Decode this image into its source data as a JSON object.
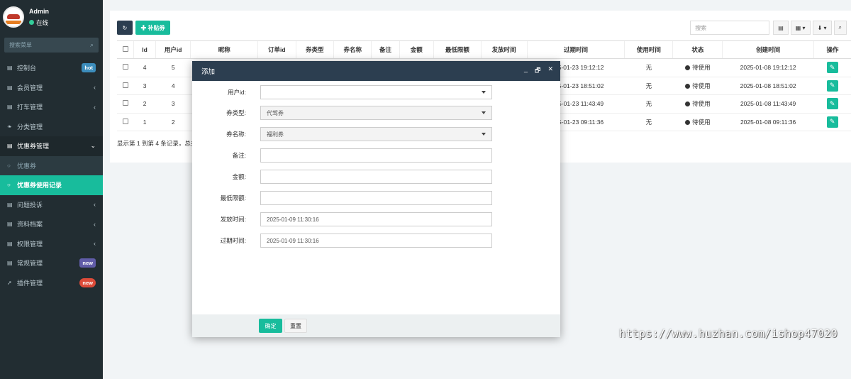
{
  "sidebar": {
    "user_name": "Admin",
    "user_status": "在线",
    "search_placeholder": "搜索菜单",
    "items": [
      {
        "label": "控制台",
        "badge": "hot",
        "badge_color": "#3c8dbc",
        "icon": "dashboard-icon"
      },
      {
        "label": "会员管理",
        "chevron": "‹",
        "icon": "list-icon"
      },
      {
        "label": "打车管理",
        "chevron": "‹",
        "icon": "list-icon"
      },
      {
        "label": "分类管理",
        "icon": "leaf-icon"
      },
      {
        "label": "优惠券管理",
        "chevron": "⌄",
        "icon": "list-icon"
      },
      {
        "label": "优惠券",
        "icon": "circle-icon"
      },
      {
        "label": "优惠券使用记录",
        "icon": "circle-icon"
      },
      {
        "label": "问题投诉",
        "chevron": "‹",
        "icon": "list-icon"
      },
      {
        "label": "资料档案",
        "chevron": "‹",
        "icon": "list-icon"
      },
      {
        "label": "权限管理",
        "chevron": "‹",
        "icon": "list-icon"
      },
      {
        "label": "常规管理",
        "badge": "new",
        "badge_color": "#605ca8",
        "icon": "list-icon"
      },
      {
        "label": "插件管理",
        "badge": "new",
        "badge_color": "#dd4b39",
        "icon": "rocket-icon"
      }
    ]
  },
  "toolbar": {
    "refresh_icon": "↻",
    "add_label": "✚ 补贴券",
    "search_placeholder": "搜索",
    "tool_view": "▤",
    "tool_columns": "▦ ▾",
    "tool_export": "⬇ ▾",
    "tool_search": "⌕"
  },
  "table": {
    "headers": [
      "",
      "Id",
      "用户id",
      "昵称",
      "订单id",
      "券类型",
      "券名称",
      "备注",
      "金额",
      "最低限额",
      "发放时间",
      "过期时间",
      "使用时间",
      "状态",
      "创建时间",
      "操作"
    ],
    "rows": [
      {
        "id": "4",
        "user_id": "5",
        "expire": "2025-01-23 19:12:12",
        "used": "无",
        "status": "待使用",
        "created": "2025-01-08 19:12:12"
      },
      {
        "id": "3",
        "user_id": "4",
        "expire": "2025-01-23 18:51:02",
        "used": "无",
        "status": "待使用",
        "created": "2025-01-08 18:51:02"
      },
      {
        "id": "2",
        "user_id": "3",
        "expire": "2025-01-23 11:43:49",
        "used": "无",
        "status": "待使用",
        "created": "2025-01-08 11:43:49"
      },
      {
        "id": "1",
        "user_id": "2",
        "expire": "2025-01-23 09:11:36",
        "used": "无",
        "status": "待使用",
        "created": "2025-01-08 09:11:36"
      }
    ],
    "pager_text": "显示第 1 到第 4 条记录，总共 4 条记录"
  },
  "modal": {
    "title": "添加",
    "ctrl_min": "_",
    "ctrl_max": "🗗",
    "ctrl_close": "✕",
    "fields": [
      {
        "label": "用户id:",
        "value": "",
        "type": "select"
      },
      {
        "label": "券类型:",
        "value": "代驾券",
        "type": "select"
      },
      {
        "label": "券名称:",
        "value": "福利券",
        "type": "select"
      },
      {
        "label": "备注:",
        "value": "",
        "type": "text"
      },
      {
        "label": "金额:",
        "value": "",
        "type": "text"
      },
      {
        "label": "最低限额:",
        "value": "",
        "type": "text"
      },
      {
        "label": "发放时间:",
        "value": "2025-01-09 11:30:16",
        "type": "text"
      },
      {
        "label": "过期时间:",
        "value": "2025-01-09 11:30:16",
        "type": "text"
      }
    ],
    "ok_label": "确定",
    "reset_label": "重置"
  },
  "watermark": "https://www.huzhan.com/ishop47020"
}
